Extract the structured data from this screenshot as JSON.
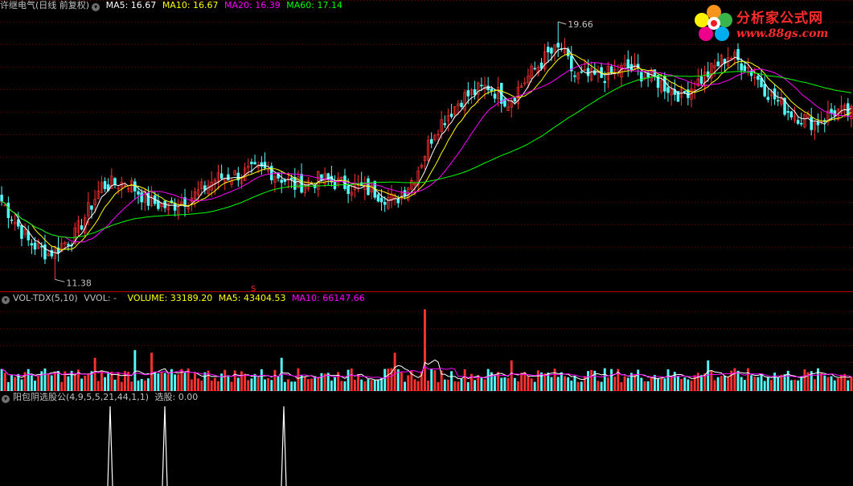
{
  "main_panel": {
    "title": "许继电气(日线 前复权)",
    "ma5": "MA5: 16.67",
    "ma10": "MA10: 16.67",
    "ma20": "MA20: 16.39",
    "ma60": "MA60: 17.14",
    "high_label": "19.66",
    "low_label": "11.38"
  },
  "vol_panel": {
    "title": "VOL-TDX(5,10)",
    "vvol": "VVOL: -",
    "volume": "VOLUME: 33189.20",
    "ma5": "MA5: 43404.53",
    "ma10": "MA10: 66147.66"
  },
  "sig_panel": {
    "title": "阳包阴选股公(4,9,5,5,21,44,1,1)",
    "value": "选股: 0.00"
  },
  "logo": {
    "brand": "分析家公式网",
    "url": "www.88gs.com"
  },
  "marker": "S",
  "colors": {
    "up": "#ff3232",
    "down": "#54fcfc",
    "ma5": "#ffffff",
    "ma10": "#ffff00",
    "ma20": "#ff00ff",
    "ma60": "#00ff00",
    "grid": "#800000",
    "signal": "#ffffff"
  },
  "chart_data": {
    "type": "candlestick",
    "price_keypoints": [
      [
        0,
        13.9
      ],
      [
        8,
        12.6
      ],
      [
        14,
        12.2
      ],
      [
        22,
        12.8
      ],
      [
        30,
        14.4
      ],
      [
        38,
        14.5
      ],
      [
        44,
        13.9
      ],
      [
        50,
        13.7
      ],
      [
        58,
        14.1
      ],
      [
        64,
        14.6
      ],
      [
        72,
        14.8
      ],
      [
        80,
        14.9
      ],
      [
        88,
        14.4
      ],
      [
        96,
        14.6
      ],
      [
        104,
        14.4
      ],
      [
        112,
        14.2
      ],
      [
        118,
        13.9
      ],
      [
        124,
        14.7
      ],
      [
        130,
        16.2
      ],
      [
        138,
        17.2
      ],
      [
        146,
        17.6
      ],
      [
        152,
        17.1
      ],
      [
        158,
        17.9
      ],
      [
        164,
        18.6
      ],
      [
        168,
        18.8
      ],
      [
        172,
        17.9
      ],
      [
        180,
        17.9
      ],
      [
        188,
        18.2
      ],
      [
        196,
        17.8
      ],
      [
        204,
        17.3
      ],
      [
        212,
        18.0
      ],
      [
        218,
        18.6
      ],
      [
        224,
        18.2
      ],
      [
        230,
        17.4
      ],
      [
        236,
        16.8
      ],
      [
        244,
        16.4
      ],
      [
        250,
        16.8
      ],
      [
        255,
        16.7
      ]
    ],
    "price_high": 19.66,
    "price_low": 11.38,
    "price_range": [
      11.0,
      20.0
    ],
    "bar_count": 256,
    "volume_spikes": [
      [
        127,
        3.2
      ],
      [
        118,
        1.5
      ],
      [
        153,
        1.2
      ],
      [
        40,
        1.6
      ],
      [
        45,
        1.5
      ],
      [
        28,
        1.3
      ],
      [
        84,
        1.3
      ],
      [
        212,
        1.2
      ]
    ],
    "signal_days": [
      32,
      49,
      85
    ],
    "series": [
      {
        "name": "MA5",
        "value": 16.67
      },
      {
        "name": "MA10",
        "value": 16.67
      },
      {
        "name": "MA20",
        "value": 16.39
      },
      {
        "name": "MA60",
        "value": 17.14
      }
    ]
  }
}
